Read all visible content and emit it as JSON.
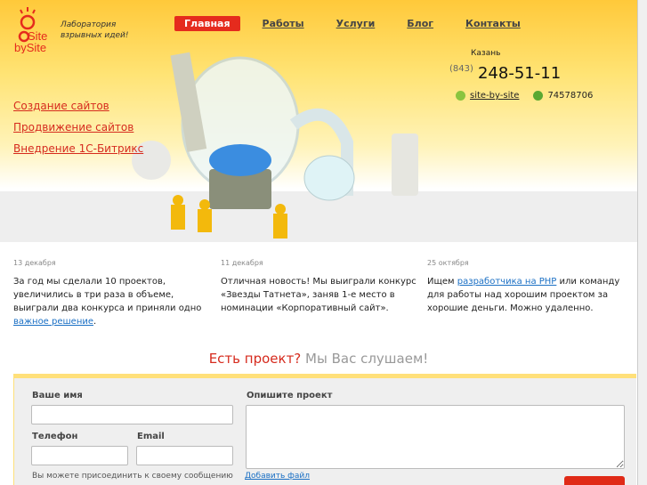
{
  "logo": {
    "text": "Site bySite"
  },
  "tagline": [
    "Лаборатория",
    "взрывных идей!"
  ],
  "nav": [
    {
      "label": "Главная",
      "active": true
    },
    {
      "label": "Работы"
    },
    {
      "label": "Услуги"
    },
    {
      "label": "Блог"
    },
    {
      "label": "Контакты"
    }
  ],
  "menu": [
    "Создание сайтов",
    "Продвижение сайтов",
    "Внедрение 1С-Битрикс"
  ],
  "contact": {
    "city": "Казань",
    "code": "(843)",
    "phone": "248-51-11",
    "skype": "site-by-site",
    "icq": "74578706"
  },
  "news": [
    {
      "date": "13 декабря",
      "text": "За год мы сделали 10 проектов, увеличились в три раза в объеме, выиграли два конкурса и приняли одно ",
      "link": "важное решение",
      "after": "."
    },
    {
      "date": "11 декабря",
      "text": "Отличная новость! Мы выиграли конкурс «Звезды Татнета», заняв 1-е место в номинации «Корпоративный сайт».",
      "link": "",
      "after": ""
    },
    {
      "date": "25 октября",
      "text": "Ищем ",
      "link": "разработчика на PHP",
      "after": " или команду для работы над хорошим проектом за хорошие деньги. Можно удаленно."
    }
  ],
  "cta": {
    "a": "Есть проект?",
    "b": " Мы Вас слушаем!"
  },
  "form": {
    "name": "Ваше имя",
    "phone": "Телефон",
    "email": "Email",
    "describe": "Опишите проект",
    "note": "Вы можете присоединить к своему сообщению",
    "attach": "Добавить файл"
  },
  "colors": {
    "accent": "#e52b1d",
    "link": "#1a6fc4"
  }
}
